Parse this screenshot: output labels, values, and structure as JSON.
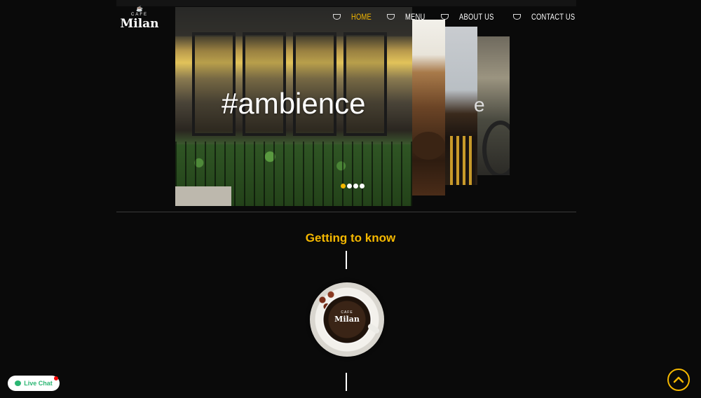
{
  "brand": {
    "small_text": "CAFE",
    "name": "Milan"
  },
  "nav": {
    "items": [
      {
        "label": "HOME",
        "active": true
      },
      {
        "label": "MENU",
        "active": false
      },
      {
        "label": "ABOUT US",
        "active": false
      },
      {
        "label": "CONTACT US",
        "active": false
      }
    ]
  },
  "slider": {
    "caption": "#ambience",
    "ghost_caption": "e",
    "slide_count": 4,
    "active_slide": 1
  },
  "section": {
    "title": "Getting to know"
  },
  "cup_logo": {
    "small_text": "CAFE",
    "name": "Milan"
  },
  "livechat": {
    "label": "Live Chat"
  },
  "colors": {
    "accent": "#f5b800",
    "background": "#0a0a0a",
    "chat_green": "#2bb673"
  },
  "icons": {
    "nav_separator": "coffee-cup-icon",
    "back_to_top": "chevron-up-icon",
    "chat": "chat-bubble-icon"
  }
}
